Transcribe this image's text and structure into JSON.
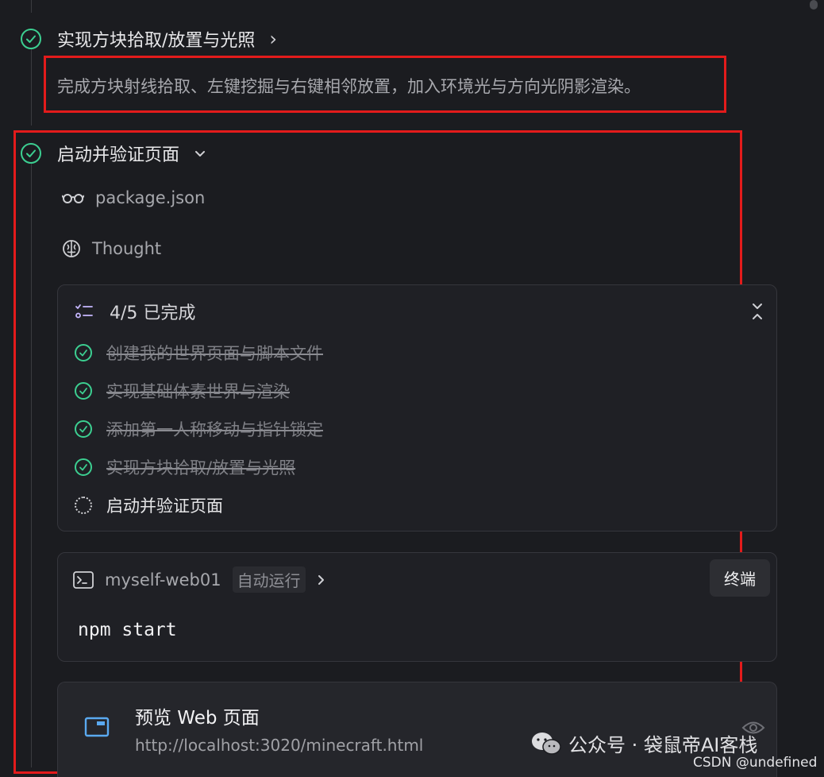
{
  "steps": [
    {
      "title": "实现方块拾取/放置与光照",
      "chevron": "›",
      "description": "完成方块射线拾取、左键挖掘与右键相邻放置，加入环境光与方向光阴影渲染。"
    },
    {
      "title": "启动并验证页面",
      "chevron": "⌄"
    }
  ],
  "file_read": {
    "icon": "glasses-icon",
    "label": "package.json"
  },
  "thought": {
    "icon": "brain-icon",
    "label": "Thought"
  },
  "todo": {
    "icon": "checklist-icon",
    "progress": "4/5 已完成",
    "items": [
      {
        "label": "创建我的世界页面与脚本文件",
        "status": "done"
      },
      {
        "label": "实现基础体素世界与渲染",
        "status": "done"
      },
      {
        "label": "添加第一人称移动与指针锁定",
        "status": "done"
      },
      {
        "label": "实现方块拾取/放置与光照",
        "status": "done"
      },
      {
        "label": "启动并验证页面",
        "status": "in-progress"
      }
    ]
  },
  "terminal": {
    "icon": "terminal-icon",
    "name": "myself-web01",
    "mode": "自动运行",
    "button": "终端",
    "command": "npm start"
  },
  "preview": {
    "icon": "browser-window-icon",
    "title": "预览 Web 页面",
    "url": "http://localhost:3020/minecraft.html"
  },
  "watermark": {
    "account": "公众号 · 袋鼠帝AI客栈",
    "csdn": "CSDN @undefined"
  },
  "colors": {
    "accent_green": "#3ccf91",
    "highlight_red": "#e31b1b",
    "preview_icon_blue": "#5aa9f0"
  }
}
